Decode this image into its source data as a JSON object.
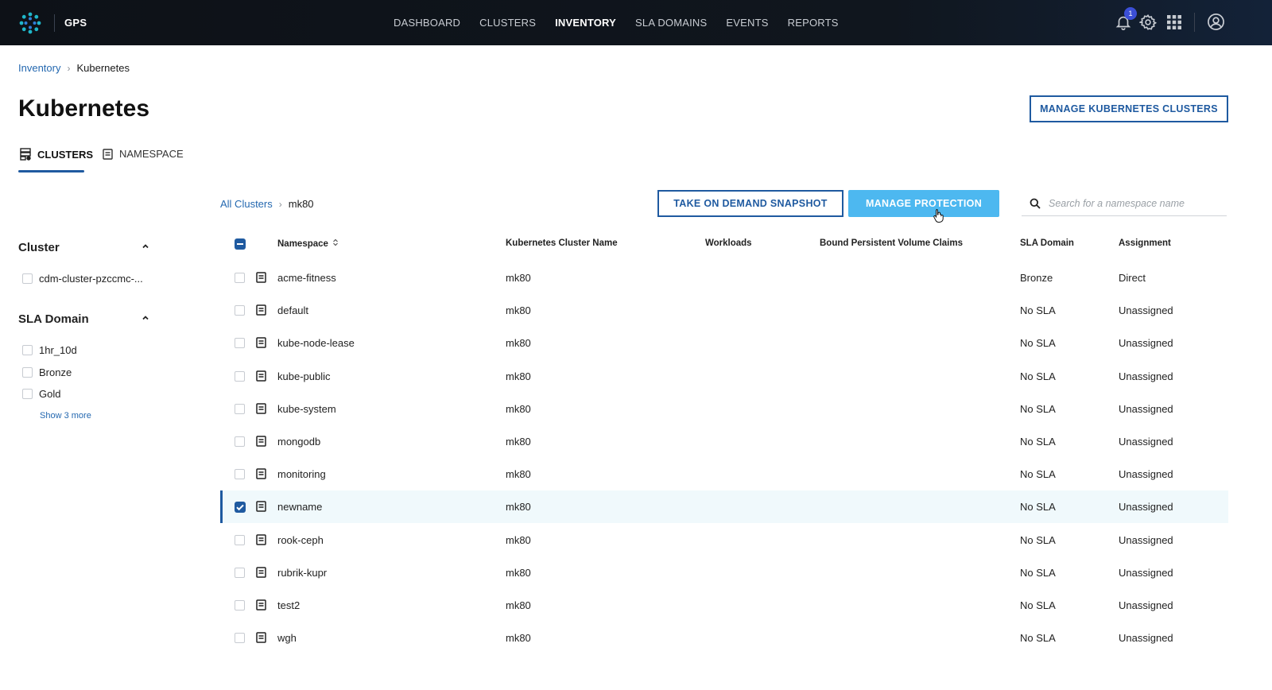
{
  "app": {
    "name": "GPS",
    "notification_count": "1"
  },
  "nav": [
    {
      "label": "DASHBOARD",
      "active": false
    },
    {
      "label": "CLUSTERS",
      "active": false
    },
    {
      "label": "INVENTORY",
      "active": true
    },
    {
      "label": "SLA DOMAINS",
      "active": false
    },
    {
      "label": "EVENTS",
      "active": false
    },
    {
      "label": "REPORTS",
      "active": false
    }
  ],
  "top_icons": [
    "bell-icon",
    "gear-icon",
    "apps-grid-icon",
    "user-avatar-icon"
  ],
  "breadcrumb": {
    "parent": "Inventory",
    "current": "Kubernetes"
  },
  "page": {
    "title": "Kubernetes",
    "manage_clusters_label": "MANAGE KUBERNETES CLUSTERS"
  },
  "tabs": [
    {
      "label": "CLUSTERS",
      "active": true
    },
    {
      "label": "NAMESPACE",
      "active": false
    }
  ],
  "filters": {
    "cluster": {
      "title": "Cluster",
      "options": [
        "cdm-cluster-pzccmc-..."
      ]
    },
    "sla_domain": {
      "title": "SLA Domain",
      "options": [
        "1hr_10d",
        "Bronze",
        "Gold"
      ],
      "show_more": "Show 3 more"
    }
  },
  "subcrumb": {
    "parent": "All Clusters",
    "current": "mk80"
  },
  "actions": {
    "snapshot_label": "TAKE ON DEMAND SNAPSHOT",
    "protection_label": "MANAGE PROTECTION",
    "search_placeholder": "Search for a namespace name"
  },
  "table": {
    "headers": {
      "namespace": "Namespace",
      "cluster_name": "Kubernetes Cluster Name",
      "workloads": "Workloads",
      "pvc": "Bound Persistent Volume Claims",
      "sla_domain": "SLA Domain",
      "assignment": "Assignment"
    },
    "rows": [
      {
        "namespace": "acme-fitness",
        "cluster": "mk80",
        "sla": "Bronze",
        "assignment": "Direct",
        "selected": false
      },
      {
        "namespace": "default",
        "cluster": "mk80",
        "sla": "No SLA",
        "assignment": "Unassigned",
        "selected": false
      },
      {
        "namespace": "kube-node-lease",
        "cluster": "mk80",
        "sla": "No SLA",
        "assignment": "Unassigned",
        "selected": false
      },
      {
        "namespace": "kube-public",
        "cluster": "mk80",
        "sla": "No SLA",
        "assignment": "Unassigned",
        "selected": false
      },
      {
        "namespace": "kube-system",
        "cluster": "mk80",
        "sla": "No SLA",
        "assignment": "Unassigned",
        "selected": false
      },
      {
        "namespace": "mongodb",
        "cluster": "mk80",
        "sla": "No SLA",
        "assignment": "Unassigned",
        "selected": false
      },
      {
        "namespace": "monitoring",
        "cluster": "mk80",
        "sla": "No SLA",
        "assignment": "Unassigned",
        "selected": false
      },
      {
        "namespace": "newname",
        "cluster": "mk80",
        "sla": "No SLA",
        "assignment": "Unassigned",
        "selected": true
      },
      {
        "namespace": "rook-ceph",
        "cluster": "mk80",
        "sla": "No SLA",
        "assignment": "Unassigned",
        "selected": false
      },
      {
        "namespace": "rubrik-kupr",
        "cluster": "mk80",
        "sla": "No SLA",
        "assignment": "Unassigned",
        "selected": false
      },
      {
        "namespace": "test2",
        "cluster": "mk80",
        "sla": "No SLA",
        "assignment": "Unassigned",
        "selected": false
      },
      {
        "namespace": "wgh",
        "cluster": "mk80",
        "sla": "No SLA",
        "assignment": "Unassigned",
        "selected": false
      }
    ]
  },
  "colors": {
    "accent": "#1f5aa0",
    "link": "#2468b0",
    "primary_button": "#4db8f0",
    "selected_row": "#f0f9fc",
    "topbar": "#0d1117"
  }
}
